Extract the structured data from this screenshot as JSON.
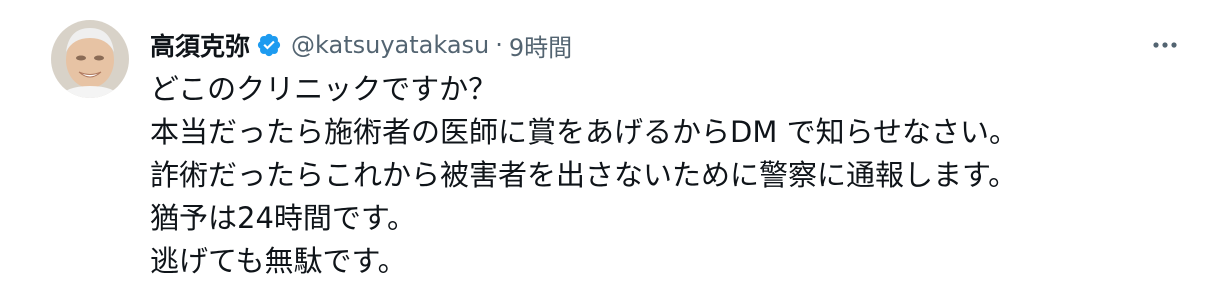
{
  "tweet": {
    "author": {
      "display_name": "高須克弥",
      "handle": "@katsuyatakasu",
      "verified": true,
      "verified_color": "#1d9bf0"
    },
    "separator": "·",
    "time": "9時間",
    "more_icon": "more-horizontal-icon",
    "lines": [
      "どこのクリニックですか？",
      "本当だったら施術者の医師に賞をあげるからDM で知らせなさい。",
      "詐術だったらこれから被害者を出さないために警察に通報します。",
      "猶予は24時間です。",
      "逃げても無駄です。"
    ]
  }
}
